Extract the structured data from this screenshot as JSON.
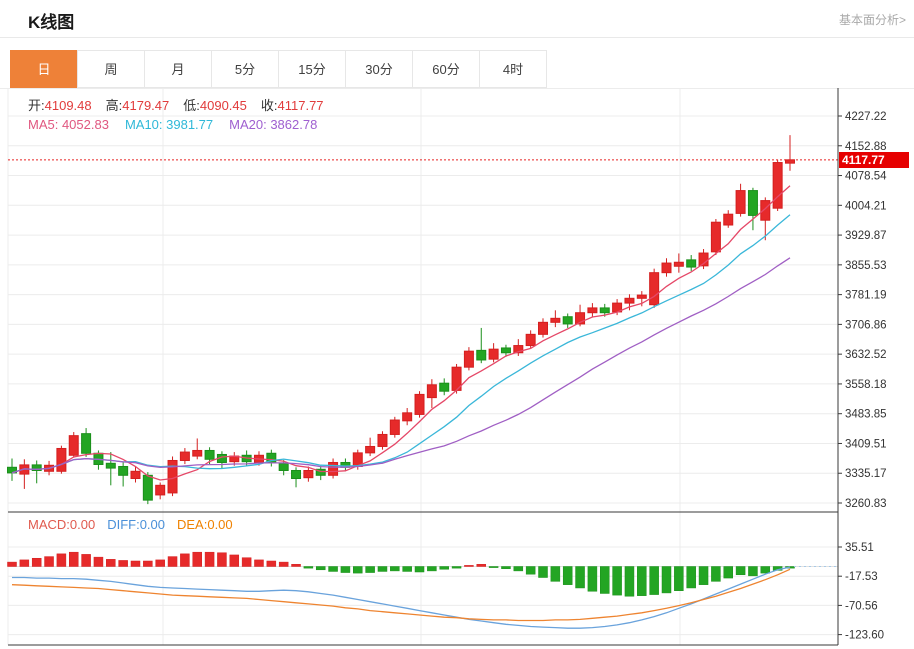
{
  "header": {
    "title": "K线图",
    "link": "基本面分析>"
  },
  "tabs": {
    "selected_index": 0,
    "items": [
      "日",
      "周",
      "月",
      "5分",
      "15分",
      "30分",
      "60分",
      "4时"
    ]
  },
  "ohlc_row": [
    {
      "label": "开:",
      "value": "4109.48"
    },
    {
      "label": "高:",
      "value": "4179.47"
    },
    {
      "label": "低:",
      "value": "4090.45"
    },
    {
      "label": "收:",
      "value": "4117.77"
    }
  ],
  "ma_row": [
    {
      "label": "MA5:",
      "value": "4052.83",
      "color": "#e05780"
    },
    {
      "label": "MA10:",
      "value": "3981.77",
      "color": "#2fb8d8"
    },
    {
      "label": "MA20:",
      "value": "3862.78",
      "color": "#9f5fd0"
    }
  ],
  "macd_row": [
    {
      "label": "MACD:",
      "value": "0.00",
      "color": "#e05a4e"
    },
    {
      "label": "DIFF:",
      "value": "0.00",
      "color": "#4a90d9"
    },
    {
      "label": "DEA:",
      "value": "0.00",
      "color": "#ef8200"
    }
  ],
  "price_tag": {
    "value": "4117.77",
    "bg": "#e60000"
  },
  "chart_data": {
    "type": "candlestick+macd",
    "title": "K线图",
    "current_price": 4117.77,
    "y_axis": {
      "top_value": 4227.22,
      "step": 74.34,
      "ticks": [
        "4227.22",
        "4152.88",
        "4078.54",
        "4004.21",
        "3929.87",
        "3855.53",
        "3781.19",
        "3706.86",
        "3632.52",
        "3558.18",
        "3483.85",
        "3409.51",
        "3335.17",
        "3260.83"
      ]
    },
    "macd_axis": {
      "top_value": 35.51,
      "step": 53.03,
      "ticks": [
        "35.51",
        "-17.53",
        "-70.56",
        "-123.60"
      ]
    },
    "ma_periods": [
      5,
      10,
      20
    ],
    "candles": [
      [
        3350,
        3336,
        3372,
        3316
      ],
      [
        3333,
        3356,
        3370,
        3296
      ],
      [
        3356,
        3342,
        3367,
        3310
      ],
      [
        3340,
        3355,
        3366,
        3330
      ],
      [
        3340,
        3397,
        3404,
        3334
      ],
      [
        3380,
        3429,
        3438,
        3374
      ],
      [
        3434,
        3385,
        3448,
        3376
      ],
      [
        3385,
        3357,
        3392,
        3344
      ],
      [
        3360,
        3348,
        3388,
        3305
      ],
      [
        3352,
        3330,
        3362,
        3302
      ],
      [
        3322,
        3340,
        3352,
        3312
      ],
      [
        3330,
        3268,
        3338,
        3258
      ],
      [
        3281,
        3305,
        3312,
        3270
      ],
      [
        3286,
        3367,
        3377,
        3278
      ],
      [
        3367,
        3388,
        3398,
        3358
      ],
      [
        3378,
        3392,
        3422,
        3370
      ],
      [
        3392,
        3370,
        3400,
        3356
      ],
      [
        3382,
        3362,
        3390,
        3348
      ],
      [
        3364,
        3378,
        3388,
        3354
      ],
      [
        3380,
        3364,
        3392,
        3352
      ],
      [
        3362,
        3380,
        3390,
        3354
      ],
      [
        3385,
        3362,
        3394,
        3352
      ],
      [
        3360,
        3342,
        3368,
        3330
      ],
      [
        3342,
        3322,
        3350,
        3300
      ],
      [
        3324,
        3342,
        3352,
        3314
      ],
      [
        3345,
        3330,
        3354,
        3318
      ],
      [
        3330,
        3362,
        3372,
        3322
      ],
      [
        3362,
        3350,
        3372,
        3340
      ],
      [
        3352,
        3386,
        3394,
        3344
      ],
      [
        3386,
        3402,
        3424,
        3378
      ],
      [
        3402,
        3432,
        3440,
        3394
      ],
      [
        3432,
        3468,
        3476,
        3424
      ],
      [
        3466,
        3486,
        3498,
        3455
      ],
      [
        3482,
        3532,
        3540,
        3474
      ],
      [
        3524,
        3556,
        3570,
        3498
      ],
      [
        3560,
        3540,
        3572,
        3530
      ],
      [
        3542,
        3600,
        3608,
        3534
      ],
      [
        3600,
        3640,
        3650,
        3592
      ],
      [
        3642,
        3618,
        3698,
        3610
      ],
      [
        3620,
        3645,
        3660,
        3612
      ],
      [
        3648,
        3636,
        3656,
        3626
      ],
      [
        3636,
        3654,
        3670,
        3628
      ],
      [
        3654,
        3682,
        3692,
        3646
      ],
      [
        3682,
        3712,
        3722,
        3674
      ],
      [
        3712,
        3722,
        3742,
        3700
      ],
      [
        3726,
        3708,
        3734,
        3698
      ],
      [
        3708,
        3736,
        3756,
        3702
      ],
      [
        3736,
        3748,
        3760,
        3726
      ],
      [
        3748,
        3736,
        3758,
        3726
      ],
      [
        3738,
        3760,
        3770,
        3730
      ],
      [
        3760,
        3772,
        3782,
        3742
      ],
      [
        3772,
        3780,
        3790,
        3752
      ],
      [
        3756,
        3836,
        3846,
        3748
      ],
      [
        3836,
        3860,
        3872,
        3826
      ],
      [
        3852,
        3862,
        3884,
        3836
      ],
      [
        3868,
        3850,
        3880,
        3840
      ],
      [
        3853,
        3885,
        3895,
        3845
      ],
      [
        3888,
        3962,
        3970,
        3880
      ],
      [
        3955,
        3982,
        3992,
        3948
      ],
      [
        3984,
        4041,
        4058,
        3976
      ],
      [
        4041,
        3979,
        4048,
        3942
      ],
      [
        3967,
        4016,
        4024,
        3917
      ],
      [
        3997,
        4111,
        4118,
        3990
      ],
      [
        4109.48,
        4117.77,
        4179.47,
        4090.45
      ]
    ],
    "macd": {
      "hist": [
        8,
        12,
        15,
        18,
        23,
        26,
        22,
        17,
        13,
        11,
        10,
        10,
        12,
        18,
        23,
        26,
        26,
        25,
        21,
        16,
        12,
        10,
        8,
        4,
        -3,
        -6,
        -9,
        -11,
        -12,
        -11,
        -9,
        -8,
        -9,
        -10,
        -8,
        -5,
        -3,
        2,
        4,
        -2,
        -4,
        -8,
        -14,
        -20,
        -27,
        -33,
        -39,
        -45,
        -49,
        -52,
        -54,
        -53,
        -51,
        -48,
        -44,
        -39,
        -33,
        -27,
        -21,
        -15,
        -17,
        -12,
        -7,
        -3
      ],
      "diff": [
        -20,
        -20,
        -21,
        -21,
        -22,
        -22,
        -23,
        -25,
        -27,
        -30,
        -33,
        -36,
        -38,
        -39,
        -40,
        -41,
        -42,
        -43,
        -44,
        -45,
        -45,
        -44,
        -43,
        -44,
        -46,
        -49,
        -52,
        -56,
        -60,
        -64,
        -68,
        -72,
        -76,
        -80,
        -84,
        -88,
        -92,
        -96,
        -99,
        -102,
        -105,
        -107,
        -109,
        -110,
        -111,
        -112,
        -112,
        -111,
        -109,
        -106,
        -102,
        -97,
        -91,
        -84,
        -76,
        -68,
        -59,
        -50,
        -41,
        -32,
        -23,
        -14,
        -6,
        -1
      ],
      "dea": [
        -33,
        -34,
        -35,
        -36,
        -37,
        -38,
        -39,
        -40,
        -42,
        -44,
        -46,
        -48,
        -50,
        -52,
        -53,
        -54,
        -55,
        -56,
        -57,
        -58,
        -60,
        -62,
        -64,
        -66,
        -68,
        -70,
        -72,
        -75,
        -77,
        -80,
        -82,
        -84,
        -86,
        -88,
        -90,
        -92,
        -93,
        -95,
        -96,
        -97,
        -97,
        -98,
        -98,
        -98,
        -97,
        -97,
        -96,
        -94,
        -92,
        -90,
        -87,
        -84,
        -80,
        -76,
        -71,
        -66,
        -60,
        -54,
        -47,
        -40,
        -32,
        -24,
        -15,
        -5
      ]
    },
    "colors": {
      "up": "#e62a2a",
      "up_stroke": "#d41f1f",
      "down": "#23a523",
      "down_stroke": "#1b8f1b",
      "ma5": "#e54868",
      "ma10": "#3ab7d9",
      "ma20": "#a05fc4",
      "diff": "#6aa3dc",
      "dea": "#ee8430",
      "price_line": "#e62222",
      "zero_dotted": "#a6c9e8",
      "grid": "#ececec",
      "axis": "#3a3a3a",
      "label": "#333333",
      "tab_selected": "#ee8138"
    }
  }
}
